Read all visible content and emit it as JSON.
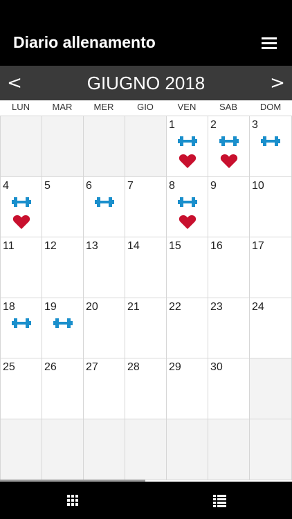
{
  "header": {
    "title": "Diario allenamento",
    "menu_icon": "hamburger-menu-icon"
  },
  "month_nav": {
    "prev_label": "<",
    "month_label": "GIUGNO 2018",
    "next_label": ">"
  },
  "weekdays": [
    "LUN",
    "MAR",
    "MER",
    "GIO",
    "VEN",
    "SAB",
    "DOM"
  ],
  "colors": {
    "dumbbell": "#1a8fcc",
    "heart": "#c8102e",
    "header_bg": "#000000",
    "month_bar_bg": "#3a3a3a"
  },
  "weeks": [
    [
      {
        "day": "",
        "empty": true
      },
      {
        "day": "",
        "empty": true
      },
      {
        "day": "",
        "empty": true
      },
      {
        "day": "",
        "empty": true
      },
      {
        "day": "1",
        "workout": true,
        "heart": true
      },
      {
        "day": "2",
        "workout": true,
        "heart": true
      },
      {
        "day": "3",
        "workout": true,
        "heart": false
      }
    ],
    [
      {
        "day": "4",
        "workout": true,
        "heart": true
      },
      {
        "day": "5",
        "workout": false,
        "heart": false
      },
      {
        "day": "6",
        "workout": true,
        "heart": false
      },
      {
        "day": "7",
        "workout": false,
        "heart": false
      },
      {
        "day": "8",
        "workout": true,
        "heart": true
      },
      {
        "day": "9",
        "workout": false,
        "heart": false
      },
      {
        "day": "10",
        "workout": false,
        "heart": false
      }
    ],
    [
      {
        "day": "11"
      },
      {
        "day": "12"
      },
      {
        "day": "13"
      },
      {
        "day": "14"
      },
      {
        "day": "15"
      },
      {
        "day": "16"
      },
      {
        "day": "17"
      }
    ],
    [
      {
        "day": "18",
        "workout": true
      },
      {
        "day": "19",
        "workout": true
      },
      {
        "day": "20"
      },
      {
        "day": "21"
      },
      {
        "day": "22"
      },
      {
        "day": "23"
      },
      {
        "day": "24"
      }
    ],
    [
      {
        "day": "25"
      },
      {
        "day": "26"
      },
      {
        "day": "27"
      },
      {
        "day": "28"
      },
      {
        "day": "29"
      },
      {
        "day": "30"
      },
      {
        "day": "",
        "empty": true
      }
    ],
    [
      {
        "day": "",
        "empty": true
      },
      {
        "day": "",
        "empty": true
      },
      {
        "day": "",
        "empty": true
      },
      {
        "day": "",
        "empty": true
      },
      {
        "day": "",
        "empty": true
      },
      {
        "day": "",
        "empty": true
      },
      {
        "day": "",
        "empty": true
      }
    ]
  ],
  "bottom_nav": {
    "grid_icon": "calendar-grid-icon",
    "list_icon": "list-view-icon"
  }
}
